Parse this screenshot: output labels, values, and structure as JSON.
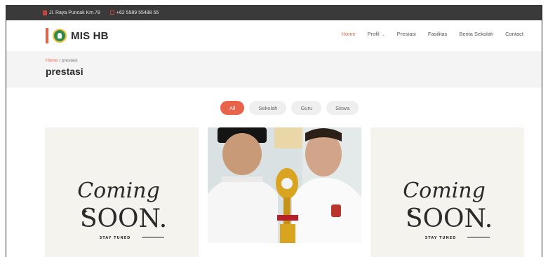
{
  "topbar": {
    "address": "Jl. Raya Puncak Km.78",
    "phone": "+62 5589 55488 55"
  },
  "header": {
    "logo_text": "MIS HB",
    "nav": [
      {
        "label": "Home",
        "active": true
      },
      {
        "label": "Profil",
        "active": false,
        "has_caret": true
      },
      {
        "label": "Prestasi",
        "active": false
      },
      {
        "label": "Fasilitas",
        "active": false
      },
      {
        "label": "Berita Sekolah",
        "active": false
      },
      {
        "label": "Contact",
        "active": false
      }
    ]
  },
  "breadcrumb": {
    "home": "Home",
    "separator": "/",
    "current": "prestasi"
  },
  "page_title": "prestasi",
  "filters": [
    {
      "label": "All",
      "active": true
    },
    {
      "label": "Sekolah",
      "active": false
    },
    {
      "label": "Guru",
      "active": false
    },
    {
      "label": "Siswa",
      "active": false
    }
  ],
  "gallery": {
    "soon_line1": "Coming",
    "soon_line2": "SOON.",
    "soon_line3": "STAY TUNED"
  },
  "colors": {
    "accent": "#e8634a",
    "topbar": "#3a3a3a",
    "soon_bg": "#f5f3ee"
  }
}
